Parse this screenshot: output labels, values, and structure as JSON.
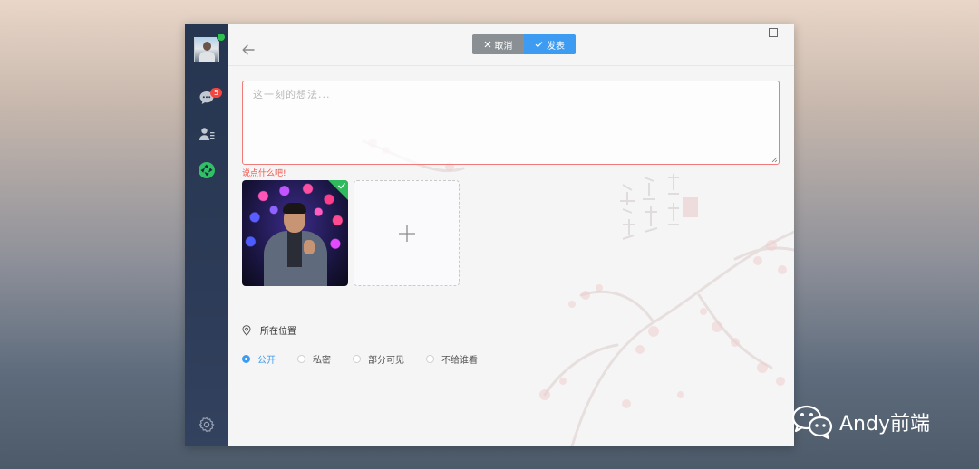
{
  "sidebar": {
    "unread_count": "5"
  },
  "toolbar": {
    "cancel_label": "取消",
    "publish_label": "发表"
  },
  "composer": {
    "placeholder": "这一刻的想法...",
    "value": "",
    "error_message": "说点什么吧!"
  },
  "location": {
    "label": "所在位置"
  },
  "visibility": {
    "selected": "公开",
    "options": [
      "公开",
      "私密",
      "部分可见",
      "不给谁看"
    ]
  },
  "watermark": {
    "text": "Andy前端"
  },
  "colors": {
    "sidebar": "#263550",
    "accent": "#3d9cf2",
    "error": "#f0554d",
    "online": "#2fc14f",
    "selected_badge": "#2fba5d"
  }
}
